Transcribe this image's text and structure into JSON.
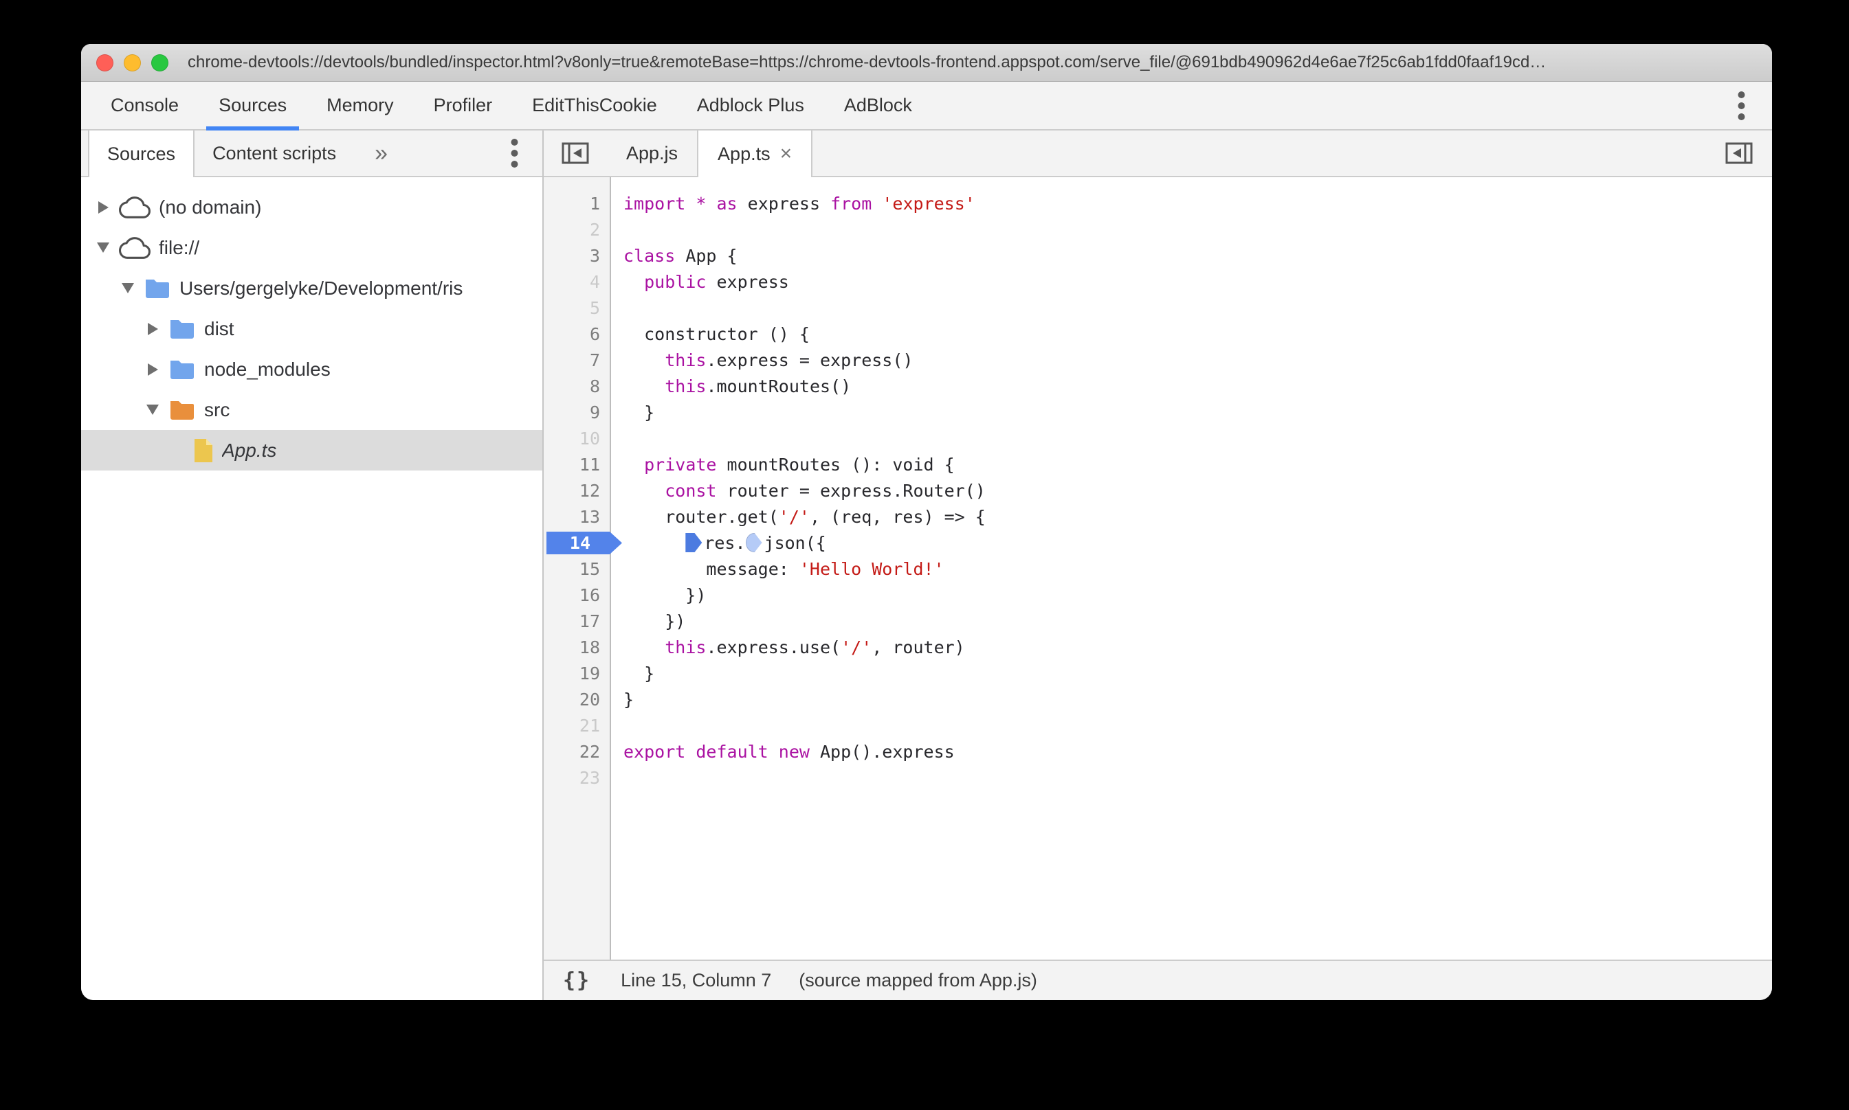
{
  "window": {
    "url": "chrome-devtools://devtools/bundled/inspector.html?v8only=true&remoteBase=https://chrome-devtools-frontend.appspot.com/serve_file/@691bdb490962d4e6ae7f25c6ab1fdd0faaf19cd…"
  },
  "main_tabs": [
    {
      "label": "Console",
      "active": false
    },
    {
      "label": "Sources",
      "active": true
    },
    {
      "label": "Memory",
      "active": false
    },
    {
      "label": "Profiler",
      "active": false
    },
    {
      "label": "EditThisCookie",
      "active": false
    },
    {
      "label": "Adblock Plus",
      "active": false
    },
    {
      "label": "AdBlock",
      "active": false
    }
  ],
  "sidebar": {
    "tabs": [
      {
        "label": "Sources",
        "active": true
      },
      {
        "label": "Content scripts",
        "active": false
      }
    ],
    "overflow_chevron": "»",
    "tree": [
      {
        "label": "(no domain)",
        "icon": "cloud",
        "arrow": "right",
        "indent": 0,
        "selected": false,
        "italic": false
      },
      {
        "label": "file://",
        "icon": "cloud",
        "arrow": "down",
        "indent": 0,
        "selected": false,
        "italic": false
      },
      {
        "label": "Users/gergelyke/Development/ris",
        "icon": "folder-blue",
        "arrow": "down",
        "indent": 1,
        "selected": false,
        "italic": false
      },
      {
        "label": "dist",
        "icon": "folder-blue",
        "arrow": "right",
        "indent": 2,
        "selected": false,
        "italic": false
      },
      {
        "label": "node_modules",
        "icon": "folder-blue",
        "arrow": "right",
        "indent": 2,
        "selected": false,
        "italic": false
      },
      {
        "label": "src",
        "icon": "folder-orange",
        "arrow": "down",
        "indent": 2,
        "selected": false,
        "italic": false
      },
      {
        "label": "App.ts",
        "icon": "file-yellow",
        "arrow": "none",
        "indent": 3,
        "selected": true,
        "italic": true
      }
    ]
  },
  "editor": {
    "tabs": [
      {
        "label": "App.js",
        "active": false,
        "closable": false
      },
      {
        "label": "App.ts",
        "active": true,
        "closable": true
      }
    ],
    "close_glyph": "×"
  },
  "code": {
    "lines": [
      {
        "n": 1,
        "tokens": [
          {
            "t": "import",
            "c": "k"
          },
          {
            "t": " ",
            "c": "d"
          },
          {
            "t": "*",
            "c": "k"
          },
          {
            "t": " ",
            "c": "d"
          },
          {
            "t": "as",
            "c": "k"
          },
          {
            "t": " express ",
            "c": "d"
          },
          {
            "t": "from",
            "c": "k"
          },
          {
            "t": " ",
            "c": "d"
          },
          {
            "t": "'express'",
            "c": "s"
          }
        ]
      },
      {
        "n": 2,
        "dim": true,
        "tokens": []
      },
      {
        "n": 3,
        "tokens": [
          {
            "t": "class",
            "c": "k"
          },
          {
            "t": " App {",
            "c": "d"
          }
        ]
      },
      {
        "n": 4,
        "dim": true,
        "tokens": [
          {
            "t": "  ",
            "c": "d"
          },
          {
            "t": "public",
            "c": "k"
          },
          {
            "t": " express",
            "c": "d"
          }
        ]
      },
      {
        "n": 5,
        "dim": true,
        "tokens": []
      },
      {
        "n": 6,
        "tokens": [
          {
            "t": "  constructor () {",
            "c": "d"
          }
        ]
      },
      {
        "n": 7,
        "tokens": [
          {
            "t": "    ",
            "c": "d"
          },
          {
            "t": "this",
            "c": "k"
          },
          {
            "t": ".express = express()",
            "c": "d"
          }
        ]
      },
      {
        "n": 8,
        "tokens": [
          {
            "t": "    ",
            "c": "d"
          },
          {
            "t": "this",
            "c": "k"
          },
          {
            "t": ".mountRoutes()",
            "c": "d"
          }
        ]
      },
      {
        "n": 9,
        "tokens": [
          {
            "t": "  }",
            "c": "d"
          }
        ]
      },
      {
        "n": 10,
        "dim": true,
        "tokens": []
      },
      {
        "n": 11,
        "tokens": [
          {
            "t": "  ",
            "c": "d"
          },
          {
            "t": "private",
            "c": "k"
          },
          {
            "t": " mountRoutes (): void {",
            "c": "d"
          }
        ]
      },
      {
        "n": 12,
        "tokens": [
          {
            "t": "    ",
            "c": "d"
          },
          {
            "t": "const",
            "c": "k"
          },
          {
            "t": " router = express.Router()",
            "c": "d"
          }
        ]
      },
      {
        "n": 13,
        "tokens": [
          {
            "t": "    router.get(",
            "c": "d"
          },
          {
            "t": "'/'",
            "c": "s"
          },
          {
            "t": ", (req, res) => {",
            "c": "d"
          }
        ]
      },
      {
        "n": 14,
        "exec": true,
        "tokens": [
          {
            "t": "      ",
            "c": "d"
          },
          {
            "m": "dark"
          },
          {
            "t": "res.",
            "c": "d"
          },
          {
            "m": "light"
          },
          {
            "t": "json({",
            "c": "d"
          }
        ]
      },
      {
        "n": 15,
        "tokens": [
          {
            "t": "        message: ",
            "c": "d"
          },
          {
            "t": "'Hello World!'",
            "c": "s"
          }
        ]
      },
      {
        "n": 16,
        "tokens": [
          {
            "t": "      })",
            "c": "d"
          }
        ]
      },
      {
        "n": 17,
        "tokens": [
          {
            "t": "    })",
            "c": "d"
          }
        ]
      },
      {
        "n": 18,
        "tokens": [
          {
            "t": "    ",
            "c": "d"
          },
          {
            "t": "this",
            "c": "k"
          },
          {
            "t": ".express.use(",
            "c": "d"
          },
          {
            "t": "'/'",
            "c": "s"
          },
          {
            "t": ", router)",
            "c": "d"
          }
        ]
      },
      {
        "n": 19,
        "tokens": [
          {
            "t": "  }",
            "c": "d"
          }
        ]
      },
      {
        "n": 20,
        "tokens": [
          {
            "t": "}",
            "c": "d"
          }
        ]
      },
      {
        "n": 21,
        "dim": true,
        "tokens": []
      },
      {
        "n": 22,
        "tokens": [
          {
            "t": "export",
            "c": "k"
          },
          {
            "t": " ",
            "c": "d"
          },
          {
            "t": "default",
            "c": "k"
          },
          {
            "t": " ",
            "c": "d"
          },
          {
            "t": "new",
            "c": "k"
          },
          {
            "t": " App().express",
            "c": "d"
          }
        ]
      },
      {
        "n": 23,
        "dim": true,
        "tokens": []
      }
    ]
  },
  "status_bar": {
    "format_glyph": "{}",
    "position": "Line 15, Column 7",
    "source_note": "(source mapped from App.js)"
  },
  "colors": {
    "accent_blue": "#4285f4",
    "exec_badge_blue": "#5383ea",
    "keyword": "#aa12a2",
    "string": "#c41a16",
    "folder_blue": "#72a5ec",
    "folder_orange": "#e98f3c",
    "file_yellow": "#ecc64e",
    "traffic_red": "#ff5f57",
    "traffic_yellow": "#febc2e",
    "traffic_green": "#28c840"
  }
}
